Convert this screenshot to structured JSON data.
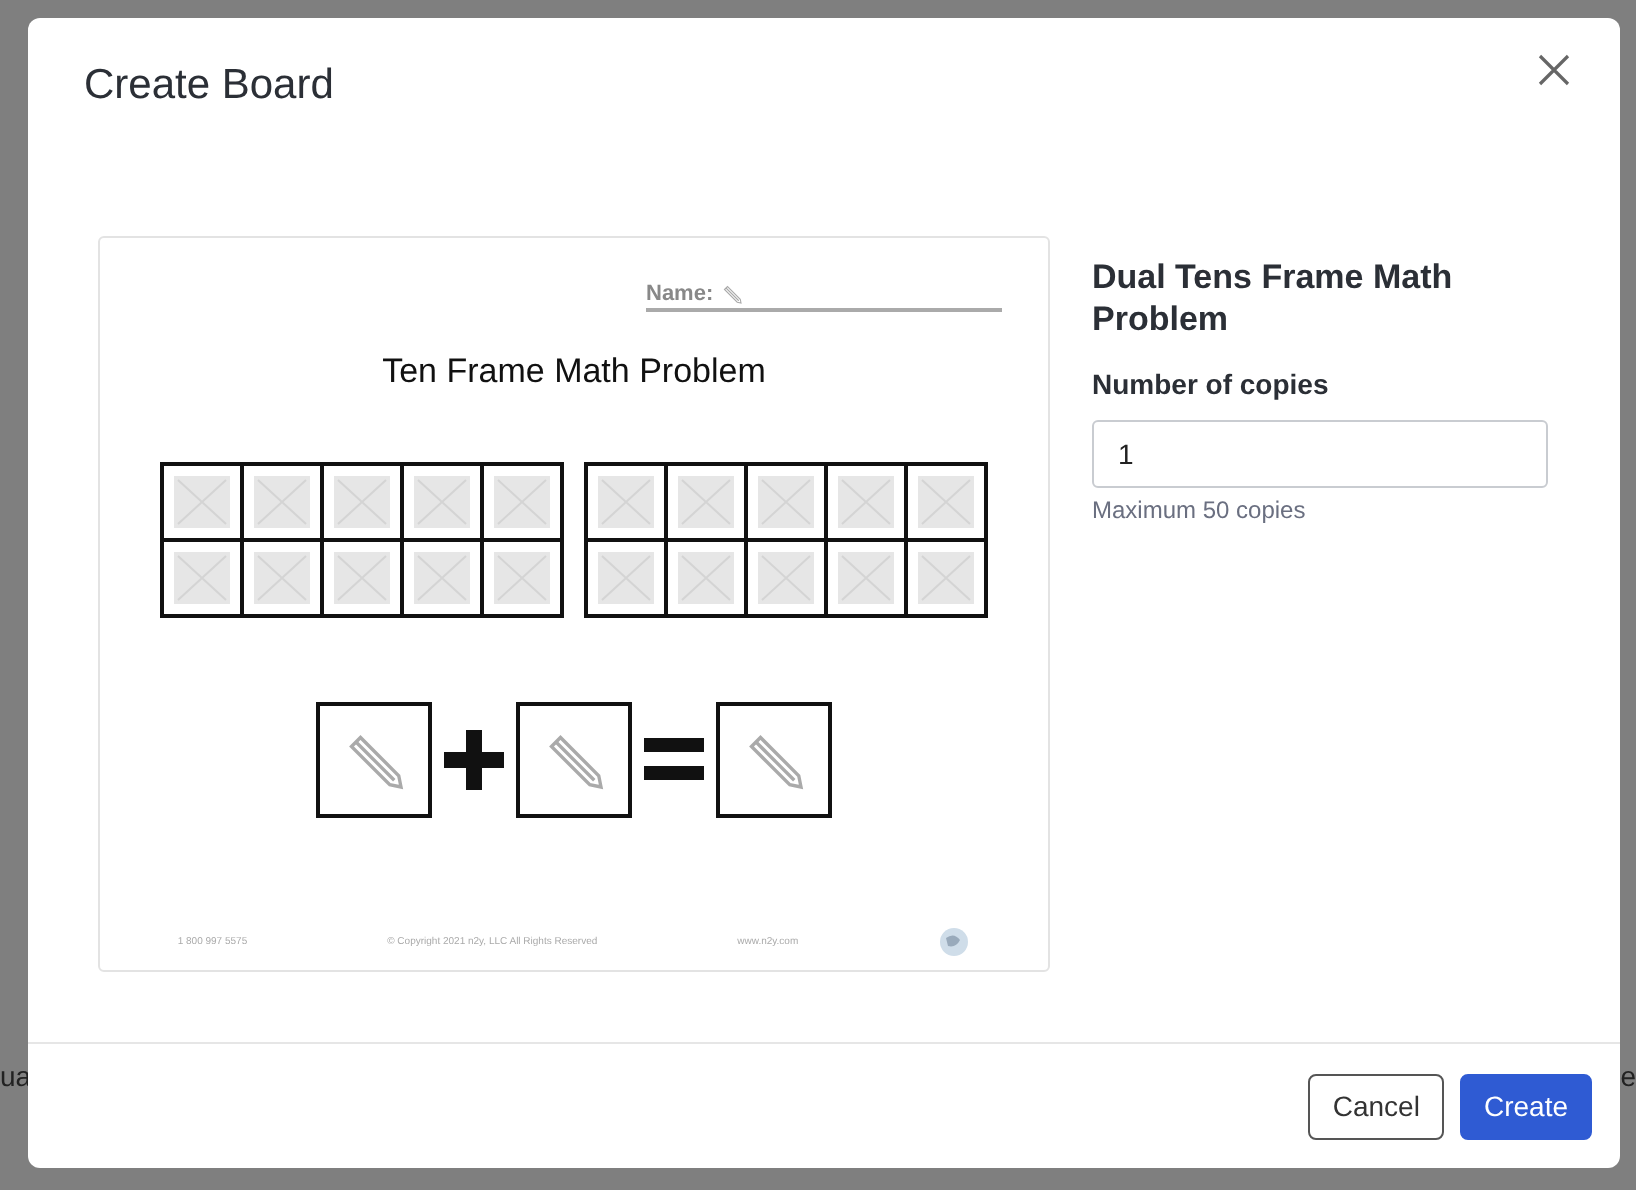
{
  "background": {
    "left_text": "ua",
    "right_text": "e"
  },
  "dialog": {
    "title": "Create Board",
    "preview": {
      "name_label": "Name:",
      "heading": "Ten Frame Math Problem",
      "ten_frames": [
        {
          "kind": "ten_frame"
        },
        {
          "kind": "ten_frame"
        }
      ],
      "equation": [
        {
          "kind": "blank"
        },
        {
          "kind": "plus"
        },
        {
          "kind": "blank"
        },
        {
          "kind": "equals"
        },
        {
          "kind": "blank"
        }
      ],
      "footer": [
        "1 800 997 5575",
        "© Copyright 2021 n2y, LLC All Rights Reserved",
        "www.n2y.com"
      ]
    },
    "board_name": "Dual Tens Frame Math Problem",
    "copies_label": "Number of copies",
    "copies_value": "1",
    "copies_hint": "Maximum 50 copies",
    "buttons": [
      {
        "label": "Cancel",
        "kind": "secondary"
      },
      {
        "label": "Create",
        "kind": "primary"
      }
    ]
  }
}
